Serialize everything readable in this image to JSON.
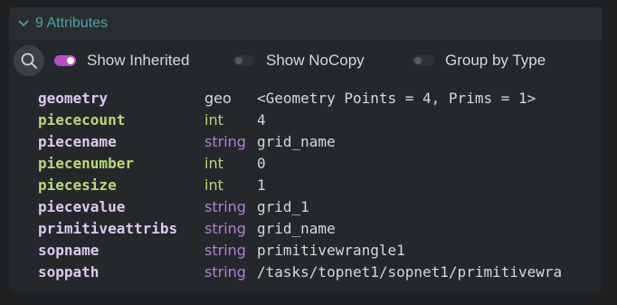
{
  "header": {
    "title": "9 Attributes",
    "icon": "chevron-down-icon"
  },
  "toolbar": {
    "search_icon": "search-icon",
    "show_inherited": {
      "label": "Show Inherited",
      "on": true
    },
    "show_nocopy": {
      "label": "Show NoCopy",
      "on": false
    },
    "group_by_type": {
      "label": "Group by Type",
      "on": false
    }
  },
  "colors": {
    "header_text": "#4aa3a4",
    "name_default": "#dcc8f0",
    "name_int": "#b9d97a",
    "type_string": "#b07fd6",
    "type_int": "#b9d97a",
    "type_geo": "#d8d8d8",
    "toggle_on": "#b94ec4"
  },
  "attributes": [
    {
      "name": "geometry",
      "type": "geo",
      "value": "<Geometry Points = 4, Prims = 1>"
    },
    {
      "name": "piececount",
      "type": "int",
      "value": "4"
    },
    {
      "name": "piecename",
      "type": "string",
      "value": "grid_name"
    },
    {
      "name": "piecenumber",
      "type": "int",
      "value": "0"
    },
    {
      "name": "piecesize",
      "type": "int",
      "value": "1"
    },
    {
      "name": "piecevalue",
      "type": "string",
      "value": "grid_1"
    },
    {
      "name": "primitiveattribs",
      "type": "string",
      "value": "grid_name"
    },
    {
      "name": "sopname",
      "type": "string",
      "value": "primitivewrangle1"
    },
    {
      "name": "soppath",
      "type": "string",
      "value": "/tasks/topnet1/sopnet1/primitivewra"
    }
  ]
}
